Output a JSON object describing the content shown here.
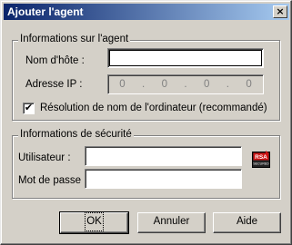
{
  "window": {
    "title": "Ajouter l'agent",
    "close_glyph": "×"
  },
  "agent_group": {
    "legend": "Informations sur l'agent",
    "hostname_label": "Nom d'hôte :",
    "hostname_value": "",
    "ip_label": "Adresse IP :",
    "ip_octets": [
      "0",
      "0",
      "0",
      "0"
    ],
    "ip_dots": [
      ".",
      ".",
      "."
    ],
    "resolve_checkbox_label": "Résolution de nom de l'ordinateur (recommandé)",
    "resolve_checked": true,
    "check_glyph": "✔"
  },
  "security_group": {
    "legend": "Informations de sécurité",
    "user_label": "Utilisateur :",
    "user_value": "",
    "password_label": "Mot de passe :",
    "password_value": "",
    "rsa_badge_text": "RSA",
    "rsa_badge_subtext": "SECURED"
  },
  "buttons": {
    "ok": "OK",
    "cancel": "Annuler",
    "help": "Aide"
  }
}
